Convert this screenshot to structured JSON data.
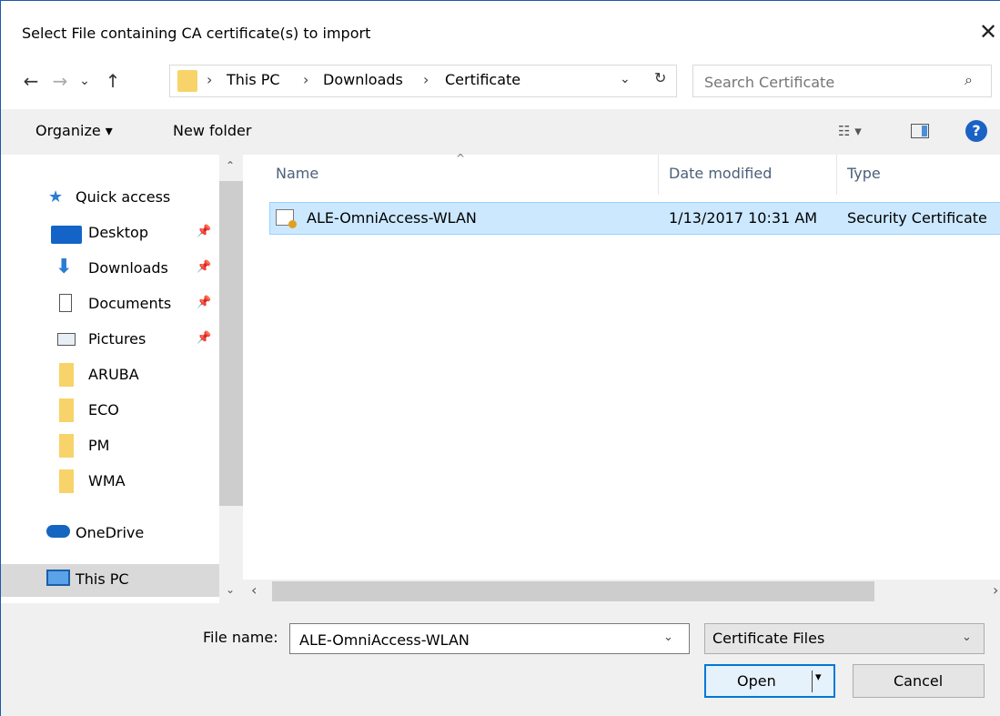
{
  "window": {
    "title": "Select File containing CA certificate(s) to import",
    "close_glyph": "✕"
  },
  "nav": {
    "back": "←",
    "forward": "→",
    "recent": "⌄",
    "up": "↑"
  },
  "address": {
    "sep": "›",
    "crumbs": [
      "This PC",
      "Downloads",
      "Certificate"
    ],
    "dropdown": "⌄",
    "refresh": "↻"
  },
  "search": {
    "placeholder": "Search Certificate",
    "icon": "⌕"
  },
  "toolbar": {
    "organize": "Organize ▾",
    "new_folder": "New folder",
    "view_glyph": "☷ ▾",
    "help": "?"
  },
  "sidebar": {
    "pin": "📌",
    "items": [
      {
        "label": "Quick access",
        "icon": "star-icon"
      },
      {
        "label": "Desktop",
        "icon": "desktop-icon",
        "pinned": true
      },
      {
        "label": "Downloads",
        "icon": "download-icon",
        "pinned": true
      },
      {
        "label": "Documents",
        "icon": "document-icon",
        "pinned": true
      },
      {
        "label": "Pictures",
        "icon": "pictures-icon",
        "pinned": true
      },
      {
        "label": "ARUBA",
        "icon": "folder-icon"
      },
      {
        "label": "ECO",
        "icon": "folder-icon"
      },
      {
        "label": "PM",
        "icon": "folder-icon"
      },
      {
        "label": "WMA",
        "icon": "folder-icon"
      },
      {
        "label": "OneDrive",
        "icon": "cloud-icon"
      },
      {
        "label": "This PC",
        "icon": "computer-icon",
        "selected": true
      }
    ],
    "star": "★",
    "down_arrow": "⬇",
    "scroll_up": "⌃",
    "scroll_down": "⌄"
  },
  "filelist": {
    "columns": [
      "Name",
      "Date modified",
      "Type"
    ],
    "sort_caret": "^",
    "rows": [
      {
        "name": "ALE-OmniAccess-WLAN",
        "date": "1/13/2017 10:31 AM",
        "type": "Security Certificate",
        "selected": true
      }
    ],
    "scroll_left": "‹",
    "scroll_right": "›"
  },
  "bottom": {
    "file_name_label": "File name:",
    "file_name_value": "ALE-OmniAccess-WLAN",
    "dropdown": "⌄",
    "file_type": "Certificate Files",
    "open_label": "Open",
    "open_arrow": "▾",
    "cancel_label": "Cancel"
  },
  "colors": {
    "selection": "#cce8ff",
    "accent": "#0078d7",
    "folder": "#f7d36a"
  }
}
